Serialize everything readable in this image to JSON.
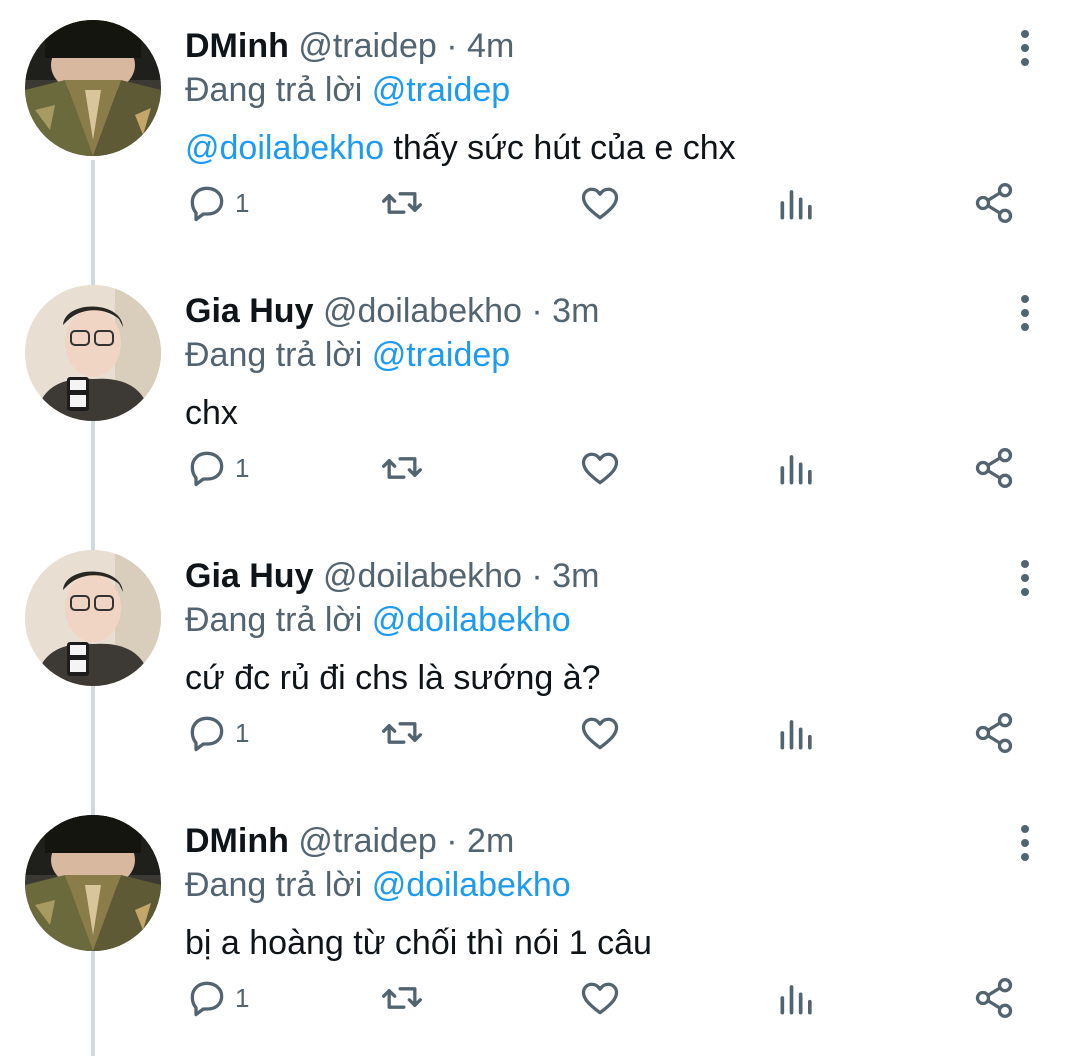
{
  "tweets": [
    {
      "display_name": "DMinh",
      "handle": "@traidep",
      "separator": "·",
      "time": "4m",
      "reply_prefix": "Đang trả lời",
      "reply_to": "@traidep",
      "mention": "@doilabekho",
      "text": "thấy sức hút của e chx",
      "reply_count": "1",
      "avatar": "dminh-avatar"
    },
    {
      "display_name": "Gia Huy",
      "handle": "@doilabekho",
      "separator": "·",
      "time": "3m",
      "reply_prefix": "Đang trả lời",
      "reply_to": "@traidep",
      "mention": "",
      "text": "chx",
      "reply_count": "1",
      "avatar": "giahuy-avatar"
    },
    {
      "display_name": "Gia Huy",
      "handle": "@doilabekho",
      "separator": "·",
      "time": "3m",
      "reply_prefix": "Đang trả lời",
      "reply_to": "@doilabekho",
      "mention": "",
      "text": "cứ đc rủ đi chs là sướng à?",
      "reply_count": "1",
      "avatar": "giahuy-avatar"
    },
    {
      "display_name": "DMinh",
      "handle": "@traidep",
      "separator": "·",
      "time": "2m",
      "reply_prefix": "Đang trả lời",
      "reply_to": "@doilabekho",
      "mention": "",
      "text": "bị a hoàng từ chối thì nói 1 câu",
      "reply_count": "1",
      "avatar": "dminh-avatar"
    }
  ],
  "colors": {
    "link": "#1d9bf0",
    "secondary_text": "#536471",
    "primary_text": "#0f1419",
    "thread_line": "#cfd9de"
  },
  "icons": [
    "reply-icon",
    "retweet-icon",
    "like-icon",
    "analytics-icon",
    "share-icon",
    "more-options-icon"
  ]
}
